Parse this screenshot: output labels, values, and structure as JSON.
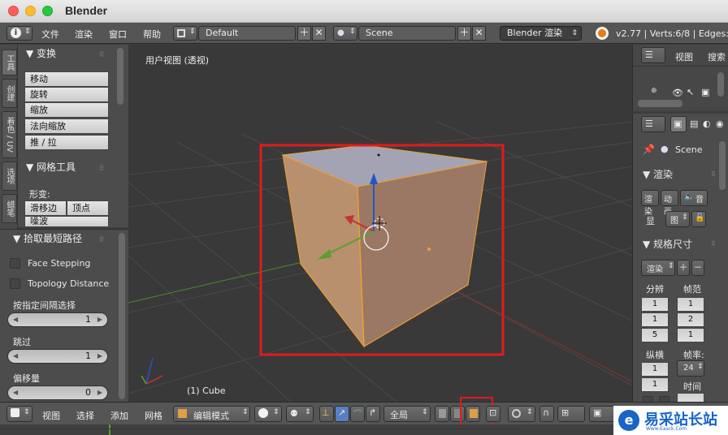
{
  "window": {
    "title": "Blender"
  },
  "topbar": {
    "menus": [
      "文件",
      "渲染",
      "窗口",
      "帮助"
    ],
    "layout_value": "Default",
    "scene_value": "Scene",
    "engine_value": "Blender 渲染",
    "stats": "v2.77 | Verts:6/8 | Edges:7/"
  },
  "tool_tabs": [
    "工具",
    "创建",
    "着色 / UV",
    "选项",
    "蜡笔"
  ],
  "transform_panel": {
    "title": "▼ 变换",
    "buttons": [
      "移动",
      "旋转",
      "缩放",
      "法向缩放",
      "推 / 拉"
    ]
  },
  "mesh_tools_panel": {
    "title": "▼ 网格工具",
    "deform_label": "形变:",
    "buttons": [
      "滑移边",
      "顶点",
      "噪波"
    ]
  },
  "operator_panel": {
    "title": "▼ 拾取最短路径",
    "checkboxes": [
      "Face Stepping",
      "Topology Distance"
    ],
    "fields": [
      {
        "label": "按指定间隔选择",
        "value": "1"
      },
      {
        "label": "跳过",
        "value": "1"
      },
      {
        "label": "偏移量",
        "value": "0"
      }
    ]
  },
  "viewport": {
    "view_label": "用户视图 (透视)",
    "object_label": "(1) Cube"
  },
  "outliner": {
    "view_menu": "视图",
    "search_menu": "搜索"
  },
  "properties": {
    "scene_name": "Scene",
    "render_panel_title": "▼ 渲染",
    "render_buttons": [
      "渲染",
      "动画",
      "音"
    ],
    "display_label": "显",
    "display_value": "图",
    "dimensions_panel_title": "▼ 规格尺寸",
    "preset_value": "渲染",
    "resolution_label": "分辨",
    "resolution_values": [
      "1",
      "1",
      "5"
    ],
    "frame_range_label": "帧范",
    "frame_range_values": [
      "1",
      "2",
      "1"
    ],
    "aspect_label": "纵横",
    "aspect_values": [
      "1",
      "1"
    ],
    "frame_rate_label": "帧率:",
    "frame_rate_value": "24",
    "time_label": "时间"
  },
  "bottombar": {
    "menus": [
      "视图",
      "选择",
      "添加",
      "网格"
    ],
    "mode_value": "编辑模式",
    "orientation_value": "全局"
  },
  "watermark": {
    "text": "易采站长站",
    "subtext": "Www.Easck.Com"
  },
  "colors": {
    "highlight_box": "#e11b1b",
    "selection_orange": "#f0a030",
    "axis_x": "#c83232",
    "axis_y": "#5aa02c",
    "axis_z": "#2456c8"
  }
}
